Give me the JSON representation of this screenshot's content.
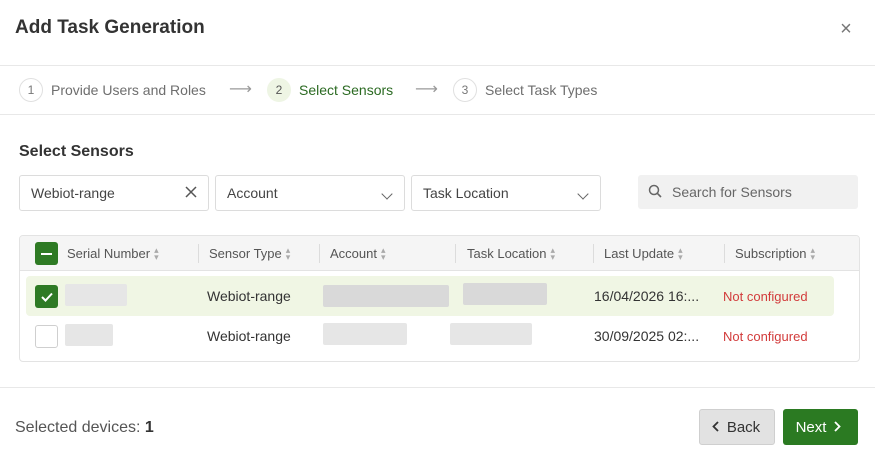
{
  "dialog": {
    "title": "Add Task Generation",
    "close_glyph": "×"
  },
  "steps": [
    {
      "num": "1",
      "label": "Provide Users and Roles",
      "active": false
    },
    {
      "num": "2",
      "label": "Select Sensors",
      "active": true
    },
    {
      "num": "3",
      "label": "Select Task Types",
      "active": false
    }
  ],
  "step_arrow": "⟶",
  "section_title": "Select Sensors",
  "filters": {
    "type_value": "Webiot-range",
    "account_placeholder": "Account",
    "location_placeholder": "Task Location",
    "search_placeholder": "Search for Sensors"
  },
  "table": {
    "columns": [
      "Serial Number",
      "Sensor Type",
      "Account",
      "Task Location",
      "Last Update",
      "Subscription"
    ],
    "rows": [
      {
        "selected": true,
        "sensor_type": "Webiot-range",
        "last_update": "16/04/2026 16:...",
        "subscription": "Not configured"
      },
      {
        "selected": false,
        "sensor_type": "Webiot-range",
        "last_update": "30/09/2025 02:...",
        "subscription": "Not configured"
      }
    ]
  },
  "footer": {
    "selected_label": "Selected devices:",
    "selected_count": "1",
    "back_label": "Back",
    "next_label": "Next"
  },
  "colors": {
    "primary": "#2b7a22",
    "selected_row": "#f0f6e4",
    "warning": "#d23b3b"
  },
  "icons": {
    "close": "close-icon",
    "clear": "clear-icon",
    "dropdown": "chevron-down-icon",
    "search": "search-icon",
    "sort": "sort-icon"
  }
}
